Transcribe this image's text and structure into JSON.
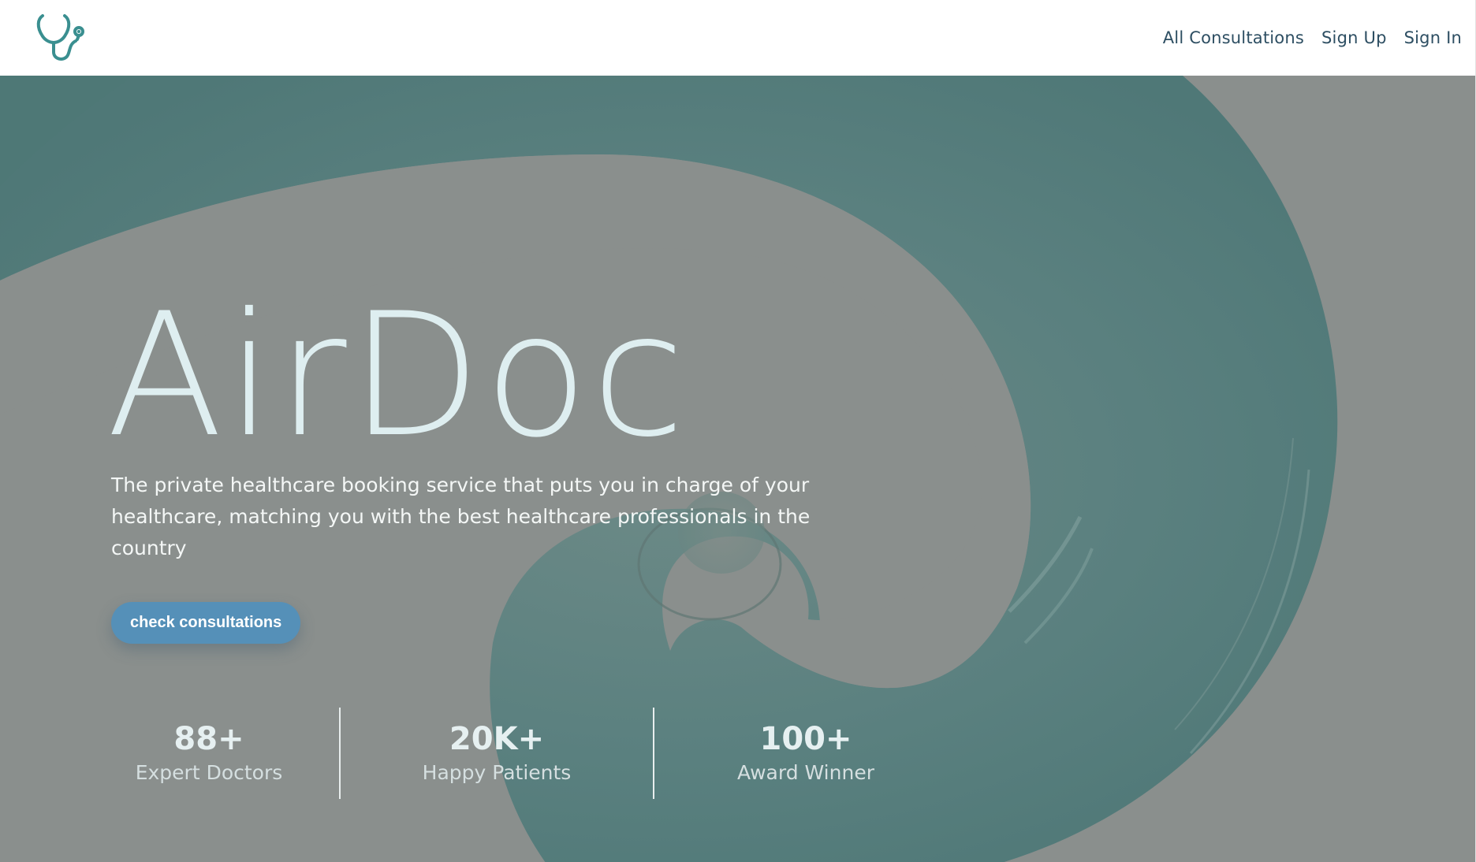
{
  "nav": {
    "logo_icon": "stethoscope-icon",
    "links": [
      {
        "label": "All Consultations"
      },
      {
        "label": "Sign Up"
      },
      {
        "label": "Sign In"
      }
    ]
  },
  "hero": {
    "title": "AirDoc",
    "subtitle": "The private healthcare booking service that puts you in charge of your healthcare, matching you with the best healthcare professionals in the country",
    "cta_label": "check consultations",
    "background_image": "teal-spiral-abstract"
  },
  "stats": [
    {
      "value": "88+",
      "label": "Expert Doctors"
    },
    {
      "value": "20K+",
      "label": "Happy Patients"
    },
    {
      "value": "100+",
      "label": "Award Winner"
    }
  ],
  "colors": {
    "accent": "#5590b8",
    "nav_text": "#2d4e62",
    "logo": "#3a8f90",
    "hero_bg": "#8a8f8d",
    "spiral": "#557f7e",
    "hero_title": "#deeef0"
  }
}
